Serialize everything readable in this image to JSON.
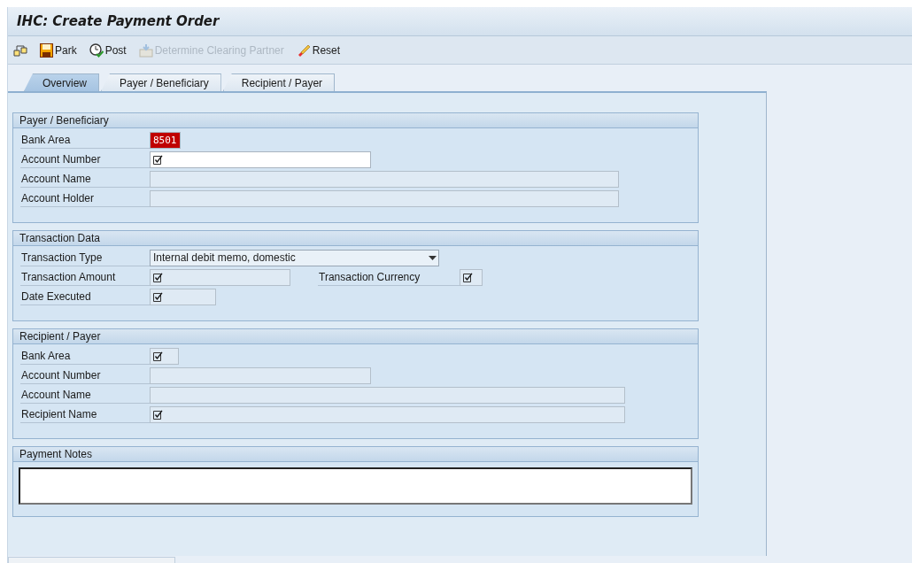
{
  "window": {
    "title": "IHC: Create Payment Order"
  },
  "toolbar": [
    {
      "kind": "other"
    },
    {
      "kind": "save",
      "label": "Park",
      "disabled": false
    },
    {
      "kind": "post",
      "label": "Post",
      "disabled": false
    },
    {
      "kind": "determine",
      "label": "Determine Clearing Partner",
      "disabled": true
    },
    {
      "kind": "reset",
      "label": "Reset",
      "disabled": false
    }
  ],
  "tabs": [
    {
      "label": "Overview",
      "selected": true
    },
    {
      "label": "Payer / Beneficiary",
      "selected": false
    },
    {
      "label": "Recipient / Payer",
      "selected": false
    }
  ],
  "sections": [
    {
      "kind": "form",
      "title": "Payer / Beneficiary",
      "rows": [
        {
          "label": "Bank Area",
          "field": {
            "kind": "input",
            "value": "8501",
            "required": false,
            "editable": true,
            "error": true
          }
        },
        {
          "label": "Account Number",
          "field": {
            "kind": "input",
            "required": true,
            "editable": true,
            "error": false
          }
        },
        {
          "label": "Account Name",
          "field": {
            "kind": "input",
            "required": false,
            "editable": false,
            "error": false
          }
        },
        {
          "label": "Account Holder",
          "field": {
            "kind": "input",
            "required": false,
            "editable": false,
            "error": false
          }
        }
      ]
    },
    {
      "kind": "form",
      "title": "Transaction Data",
      "rows": [
        {
          "label": "Transaction Type",
          "field": {
            "kind": "dropdown",
            "value": "Internal debit memo, domestic",
            "required": false,
            "editable": false,
            "error": false
          }
        },
        {
          "label": "Transaction Amount",
          "field": {
            "kind": "input",
            "required": true,
            "editable": false,
            "error": false
          },
          "extra": {
            "label": "Transaction Currency",
            "field": {
              "kind": "input",
              "required": true,
              "editable": false,
              "error": false
            }
          }
        },
        {
          "label": "Date Executed",
          "field": {
            "kind": "input",
            "required": true,
            "editable": false,
            "error": false
          }
        }
      ]
    },
    {
      "kind": "form",
      "title": "Recipient / Payer",
      "rows": [
        {
          "label": "Bank Area",
          "field": {
            "kind": "input",
            "required": true,
            "editable": false,
            "error": false
          }
        },
        {
          "label": "Account Number",
          "field": {
            "kind": "input",
            "required": false,
            "editable": false,
            "error": false
          }
        },
        {
          "label": "Account Name",
          "field": {
            "kind": "input",
            "required": false,
            "editable": false,
            "error": false
          }
        },
        {
          "label": "Recipient Name",
          "field": {
            "kind": "input",
            "required": true,
            "editable": false,
            "error": false
          }
        }
      ]
    },
    {
      "kind": "notes",
      "title": "Payment Notes"
    }
  ]
}
